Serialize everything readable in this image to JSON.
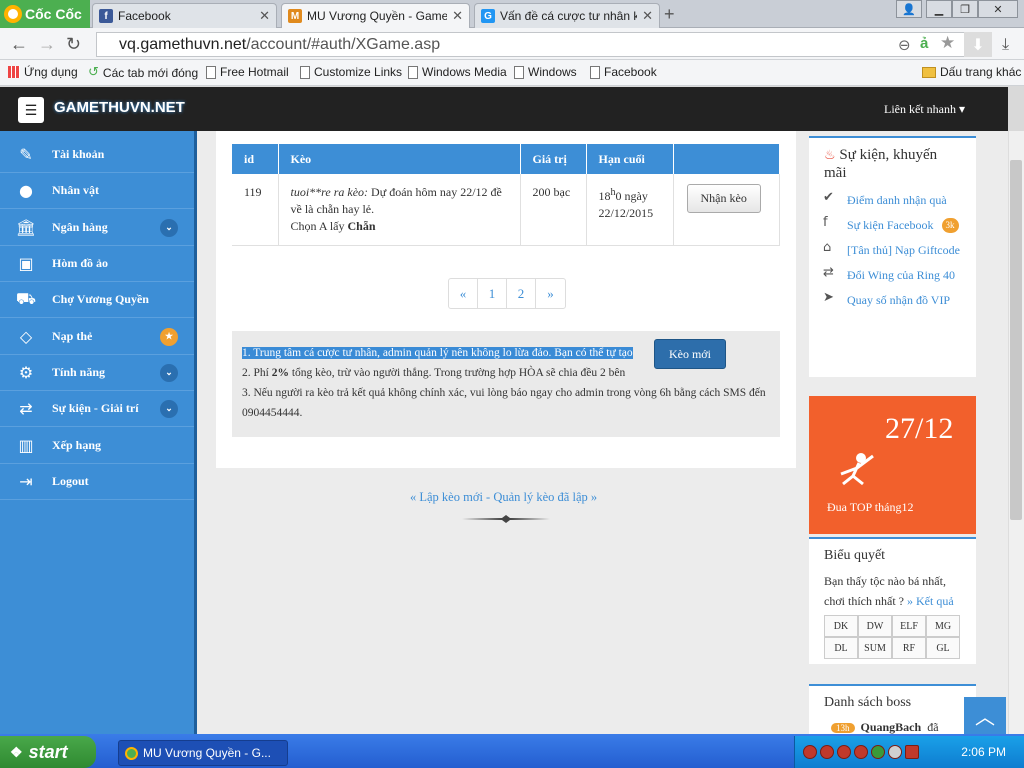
{
  "browser": {
    "logo_text": "Cốc Cốc",
    "tabs": [
      {
        "title": "Facebook",
        "favicon": "f",
        "favicon_color": "#3b5998"
      },
      {
        "title": "MU Vương Quyền - Gamethu\\",
        "favicon": "M",
        "favicon_color": "#e08a1e"
      },
      {
        "title": "Vấn đề cá cược tư nhân khôn",
        "favicon": "G",
        "favicon_color": "#2196f3"
      }
    ],
    "url_host": "vq.gamethuvn.net",
    "url_path": "/account/#auth/XGame.asp",
    "bookmarks": [
      "Ứng dụng",
      "Các tab mới đóng",
      "Free Hotmail",
      "Customize Links",
      "Windows Media",
      "Windows",
      "Facebook"
    ],
    "bookmark_folder": "Dấu trang khác"
  },
  "site": {
    "brand": "GAMETHUVN.NET",
    "quick_links": "Liên kết nhanh ▾",
    "sidebar": [
      {
        "label": "Tài khoản",
        "icon": "edit-icon",
        "glyph": "✎",
        "badge": ""
      },
      {
        "label": "Nhân vật",
        "icon": "user-icon",
        "glyph": "👤",
        "badge": ""
      },
      {
        "label": "Ngân hàng",
        "icon": "bank-icon",
        "glyph": "🏛",
        "badge": "chevron"
      },
      {
        "label": "Hòm đồ ảo",
        "icon": "briefcase-icon",
        "glyph": "💼",
        "badge": ""
      },
      {
        "label": "Chợ Vương Quyền",
        "icon": "cart-icon",
        "glyph": "🛒",
        "badge": ""
      },
      {
        "label": "Nạp thẻ",
        "icon": "diamond-icon",
        "glyph": "◇",
        "badge": "star"
      },
      {
        "label": "Tính năng",
        "icon": "cogs-icon",
        "glyph": "⚙",
        "badge": "chevron"
      },
      {
        "label": "Sự kiện - Giải trí",
        "icon": "exchange-icon",
        "glyph": "⇄",
        "badge": "chevron"
      },
      {
        "label": "Xếp hạng",
        "icon": "bar-chart-icon",
        "glyph": "▮",
        "badge": ""
      },
      {
        "label": "Logout",
        "icon": "logout-icon",
        "glyph": "⇥",
        "badge": ""
      }
    ],
    "table": {
      "headers": [
        "id",
        "Kèo",
        "Giá trị",
        "Hạn cuối",
        ""
      ],
      "row": {
        "id": "119",
        "author": "tuoi**re ra kèo:",
        "text": " Dự đoán hôm nay 22/12 đề về là chẵn hay lẻ.",
        "choose_prefix": "Chọn A lấy ",
        "choose_value": "Chẵn",
        "value": "200 bạc",
        "deadline_hour": "18",
        "deadline_sup": "h",
        "deadline_rest": "0 ngày 22/12/2015",
        "action": "Nhận kèo"
      }
    },
    "pagination": [
      "«",
      "1",
      "2",
      "»"
    ],
    "notes": {
      "line1": "1. Trung tâm cá cược tư nhân, admin quản lý nên không lo lừa đảo. Bạn có thể tự tạo",
      "line2_pre": "2. Phí ",
      "line2_bold": "2%",
      "line2_post": " tổng kèo, trừ vào người thắng. Trong trường hợp HÒA sẽ chia đều 2 bên",
      "line3": "3. Nếu người ra kèo trả kết quả không chính xác, vui lòng báo ngay cho admin trong vòng 6h bằng cách SMS đến 0904454444."
    },
    "new_button": "Kèo mới",
    "bottom_links": "«  Lập kèo mới - Quản lý kèo đã lập  »",
    "right": {
      "events_title": "Sự kiện, khuyến mãi",
      "events": [
        {
          "label": "Điểm danh nhận quà",
          "icon": "check-circle-icon",
          "glyph": "✔",
          "badge": ""
        },
        {
          "label": "Sự kiện Facebook",
          "icon": "facebook-icon",
          "glyph": "f",
          "badge": "3k"
        },
        {
          "label": "[Tân thủ] Nạp Giftcode",
          "icon": "gift-icon",
          "glyph": "🎁",
          "badge": ""
        },
        {
          "label": "Đổi Wing của Ring 40",
          "icon": "exchange-icon",
          "glyph": "⇄",
          "badge": ""
        },
        {
          "label": "Quay số nhận đồ VIP",
          "icon": "send-icon",
          "glyph": "✈",
          "badge": ""
        }
      ],
      "promo_date": "27/12",
      "promo_text": "Đua TOP tháng12",
      "poll_title": "Biểu quyết",
      "poll_question": "Bạn thấy tộc nào bá nhất, chơi thích nhất ? ",
      "poll_result": "» Kết quả",
      "poll_options": [
        "DK",
        "DW",
        "ELF",
        "MG",
        "DL",
        "SUM",
        "RF",
        "GL"
      ],
      "boss_title": "Danh sách boss",
      "boss_time": "13h",
      "boss_name": "QuangBach",
      "boss_suffix": " đã"
    }
  },
  "taskbar": {
    "start": "start",
    "task": "MU Vương Quyền - G...",
    "clock": "2:06 PM"
  }
}
